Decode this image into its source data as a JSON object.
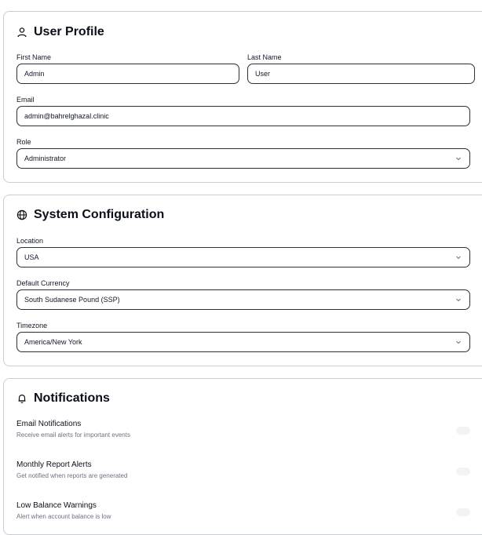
{
  "user_profile": {
    "title": "User Profile",
    "icon": "user-icon",
    "first_name": {
      "label": "First Name",
      "value": "Admin"
    },
    "last_name": {
      "label": "Last Name",
      "value": "User"
    },
    "email": {
      "label": "Email",
      "value": "admin@bahrelghazal.clinic"
    },
    "role": {
      "label": "Role",
      "value": "Administrator"
    }
  },
  "system_configuration": {
    "title": "System Configuration",
    "icon": "globe-icon",
    "location": {
      "label": "Location",
      "value": "USA"
    },
    "currency": {
      "label": "Default Currency",
      "value": "South Sudanese Pound (SSP)"
    },
    "timezone": {
      "label": "Timezone",
      "value": "America/New York"
    }
  },
  "notifications": {
    "title": "Notifications",
    "icon": "bell-icon",
    "items": [
      {
        "title": "Email Notifications",
        "description": "Receive email alerts for important events"
      },
      {
        "title": "Monthly Report Alerts",
        "description": "Get notified when reports are generated"
      },
      {
        "title": "Low Balance Warnings",
        "description": "Alert when account balance is low"
      }
    ]
  }
}
